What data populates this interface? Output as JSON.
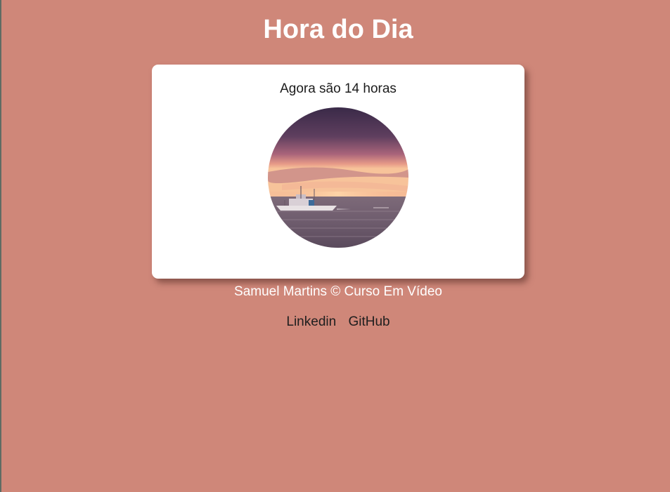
{
  "header": {
    "title": "Hora do Dia"
  },
  "card": {
    "message": "Agora são 14 horas",
    "image_description": "sunset-sea-boat"
  },
  "footer": {
    "credit": "Samuel Martins © Curso Em Vídeo",
    "links": [
      {
        "label": "Linkedin"
      },
      {
        "label": "GitHub"
      }
    ]
  },
  "colors": {
    "background": "#cf8779",
    "card": "#ffffff",
    "title": "#ffffff",
    "link": "#1e1e1e"
  }
}
